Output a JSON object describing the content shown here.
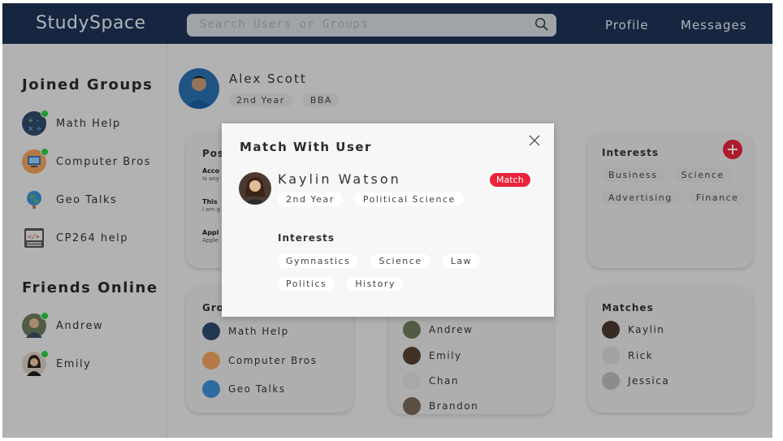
{
  "app": {
    "brand": "StudySpace",
    "search_placeholder": "Search Users or Groups",
    "nav": {
      "profile": "Profile",
      "messages": "Messages"
    }
  },
  "sidebar": {
    "groups_heading": "Joined Groups",
    "groups": [
      {
        "label": "Math Help",
        "icon": "math-icon",
        "online": true
      },
      {
        "label": "Computer Bros",
        "icon": "computer-icon",
        "online": true
      },
      {
        "label": "Geo Talks",
        "icon": "globe-icon",
        "online": false
      },
      {
        "label": "CP264 help",
        "icon": "code-icon",
        "online": false
      }
    ],
    "friends_heading": "Friends Online",
    "friends": [
      {
        "label": "Andrew",
        "online": true
      },
      {
        "label": "Emily",
        "online": true
      }
    ]
  },
  "profile": {
    "name": "Alex Scott",
    "year": "2nd Year",
    "program": "BBA"
  },
  "cards": {
    "posts": {
      "title": "Pos",
      "items": [
        {
          "title": "Acco",
          "body": "Is any"
        },
        {
          "title": "This",
          "body": "I am g"
        },
        {
          "title": "Appl",
          "body": "Apple"
        }
      ]
    },
    "groups": {
      "title": "Gro",
      "items": [
        "Math Help",
        "Computer Bros",
        "Geo Talks"
      ]
    },
    "friends": {
      "items": [
        "Andrew",
        "Emily",
        "Chan",
        "Brandon"
      ]
    },
    "interests": {
      "title": "Interests",
      "items": [
        "Business",
        "Science",
        "Advertising",
        "Finance"
      ]
    },
    "matches": {
      "title": "Matches",
      "items": [
        "Kaylin",
        "Rick",
        "Jessica"
      ]
    }
  },
  "modal": {
    "title": "Match With User",
    "user": {
      "name": "Kaylin Watson",
      "year": "2nd Year",
      "program": "Political Science"
    },
    "match_label": "Match",
    "interests_title": "Interests",
    "interests": [
      "Gymnastics",
      "Science",
      "Law",
      "Politics",
      "History"
    ]
  },
  "colors": {
    "topbar": "#1e3356",
    "accent": "#e8233a",
    "online": "#2ecc40"
  }
}
